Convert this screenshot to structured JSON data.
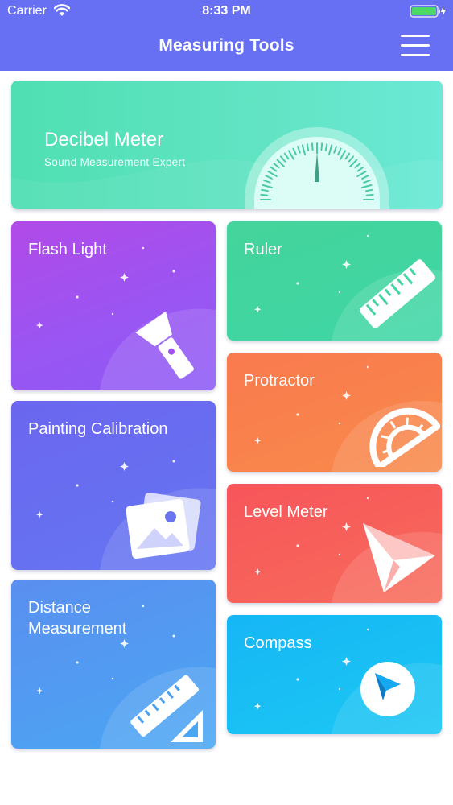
{
  "status_bar": {
    "carrier": "Carrier",
    "time": "8:33 PM"
  },
  "header": {
    "title": "Measuring Tools",
    "background_color": "#6770f2"
  },
  "tools": {
    "decibel_meter": {
      "title": "Decibel Meter",
      "subtitle": "Sound Measurement Expert",
      "icon": "decibel-gauge-icon"
    },
    "flash_light": {
      "title": "Flash Light",
      "icon": "flashlight-icon"
    },
    "painting_calibration": {
      "title": "Painting Calibration",
      "icon": "picture-icon"
    },
    "distance_measurement": {
      "title": "Distance\nMeasurement",
      "icon": "ruler-triangle-icon"
    },
    "ruler": {
      "title": "Ruler",
      "icon": "ruler-icon"
    },
    "protractor": {
      "title": "Protractor",
      "icon": "protractor-icon"
    },
    "level_meter": {
      "title": "Level Meter",
      "icon": "paper-plane-icon"
    },
    "compass": {
      "title": "Compass",
      "icon": "compass-icon"
    }
  }
}
